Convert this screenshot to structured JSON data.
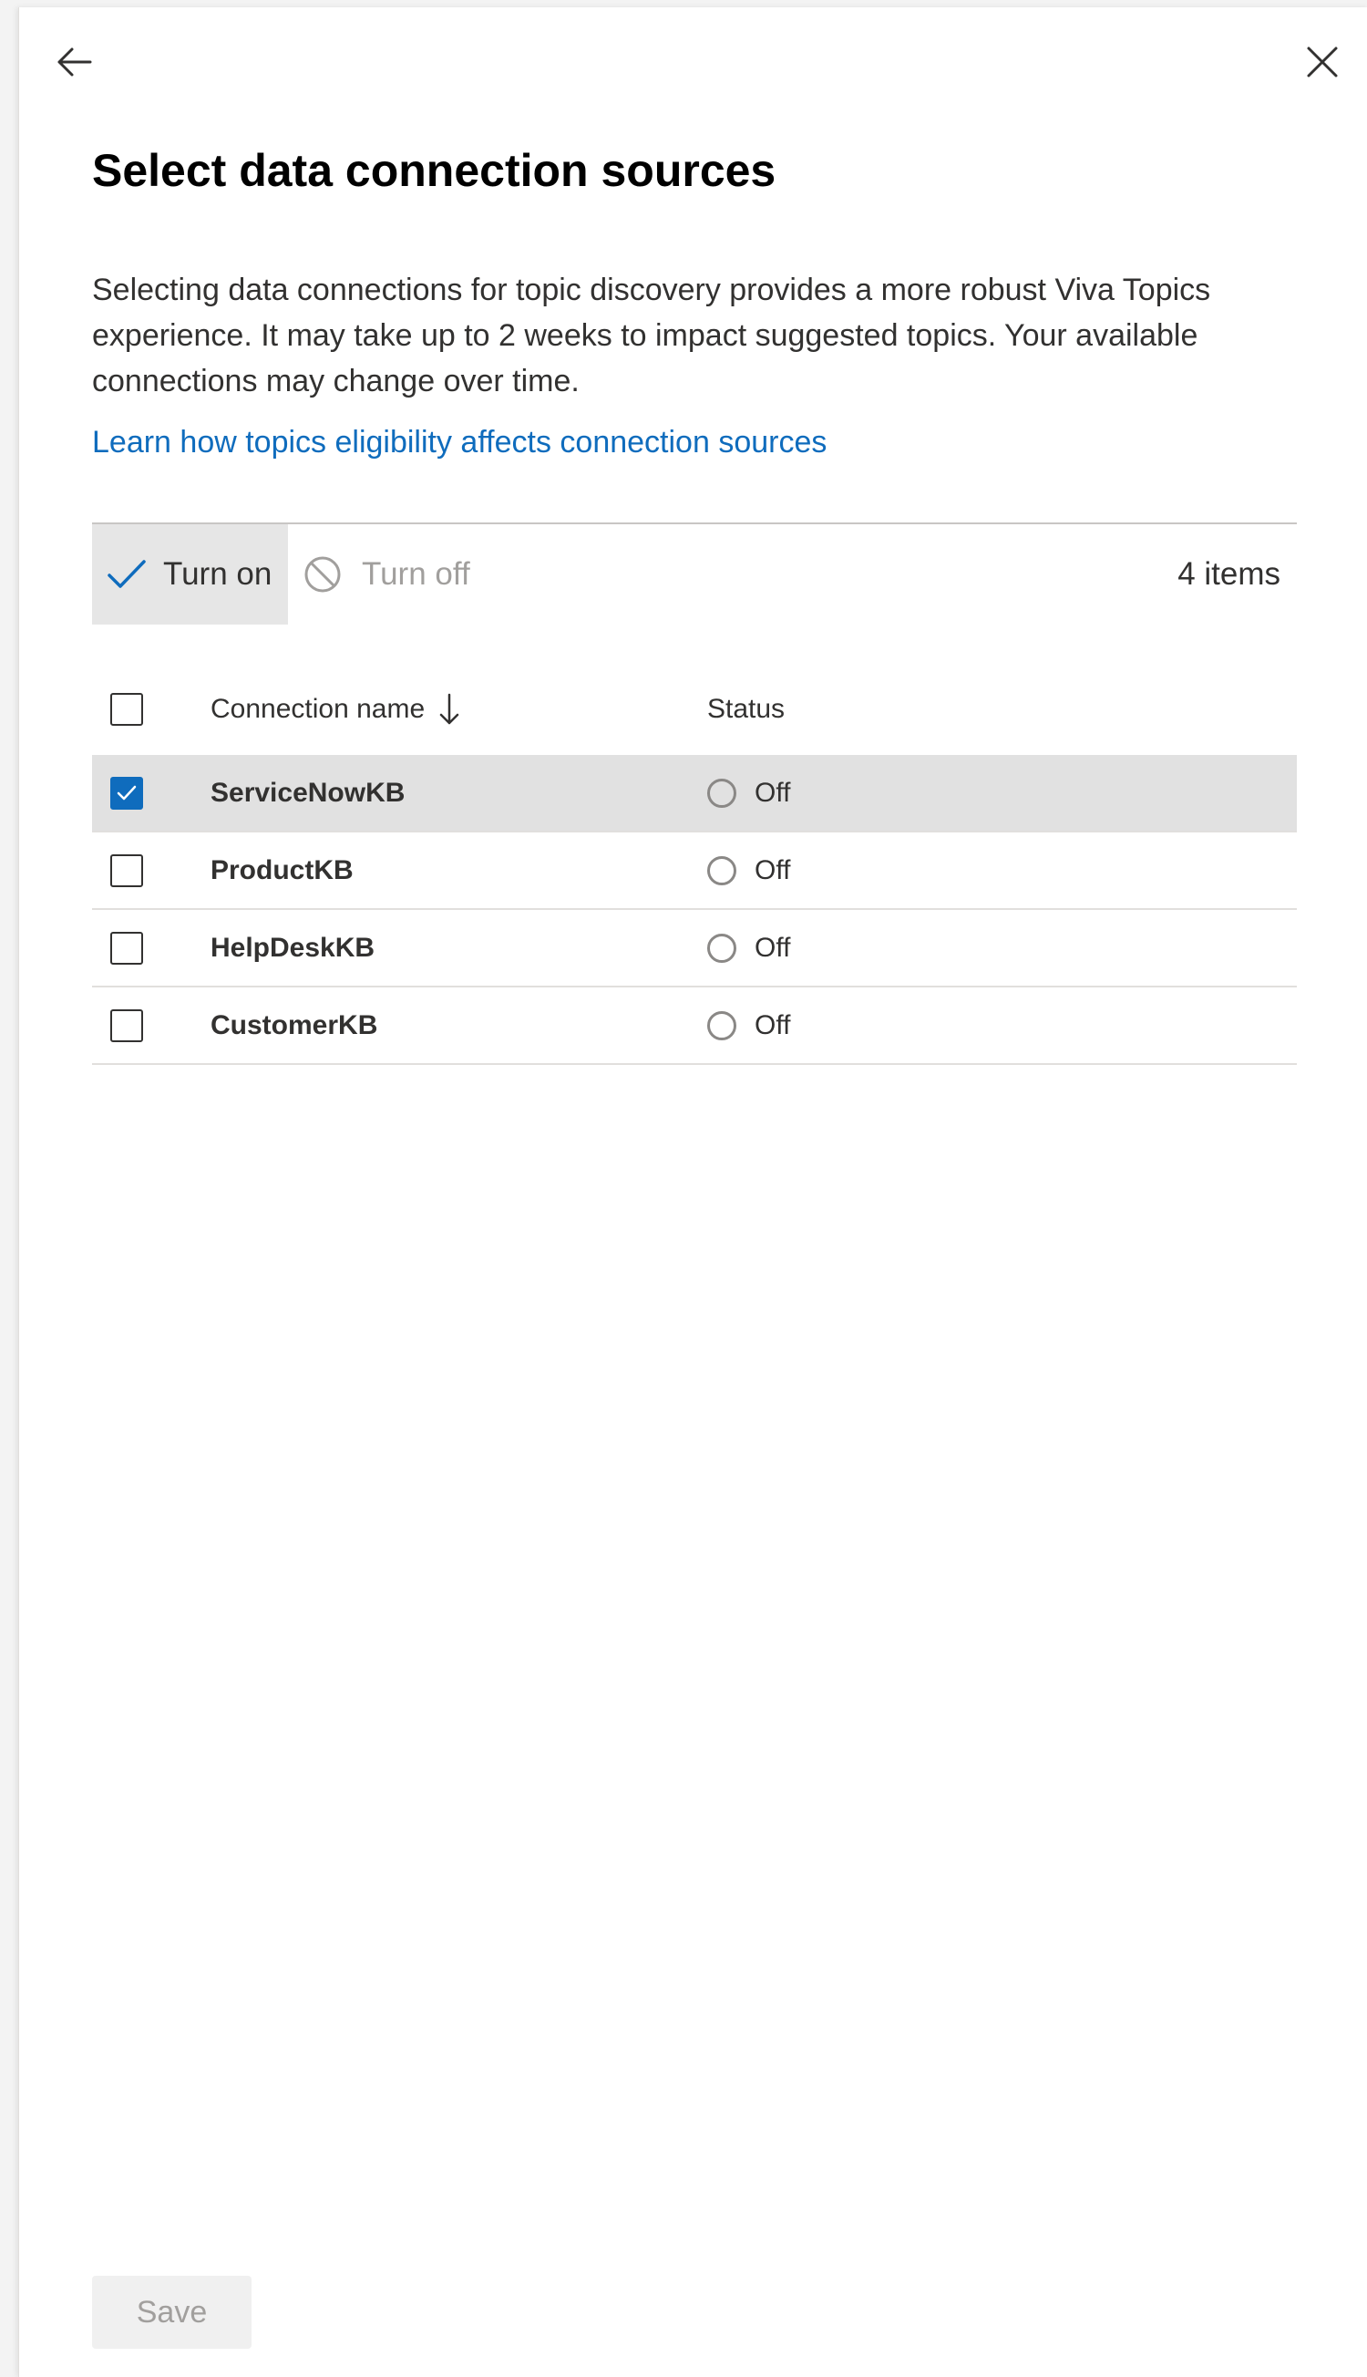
{
  "panel": {
    "title": "Select data connection sources",
    "description": "Selecting data connections for topic discovery provides a more robust Viva Topics experience. It may take up to 2 weeks to impact suggested topics. Your available connections may change over time.",
    "learn_link": "Learn how topics eligibility affects connection sources",
    "back_icon": "arrow-left-icon",
    "close_icon": "close-icon"
  },
  "command_bar": {
    "turn_on_label": "Turn on",
    "turn_on_icon": "checkmark-icon",
    "turn_off_label": "Turn off",
    "turn_off_icon": "blocked-icon",
    "item_count": "4 items"
  },
  "table": {
    "columns": {
      "name": "Connection name",
      "status": "Status",
      "sort_icon": "arrow-down-icon"
    },
    "rows": [
      {
        "name": "ServiceNowKB",
        "status": "Off",
        "checked": true
      },
      {
        "name": "ProductKB",
        "status": "Off",
        "checked": false
      },
      {
        "name": "HelpDeskKB",
        "status": "Off",
        "checked": false
      },
      {
        "name": "CustomerKB",
        "status": "Off",
        "checked": false
      }
    ]
  },
  "footer": {
    "save_label": "Save"
  },
  "colors": {
    "accent": "#0f6cbd",
    "selected_row": "#e1e1e1",
    "disabled_text": "#a19f9d"
  }
}
